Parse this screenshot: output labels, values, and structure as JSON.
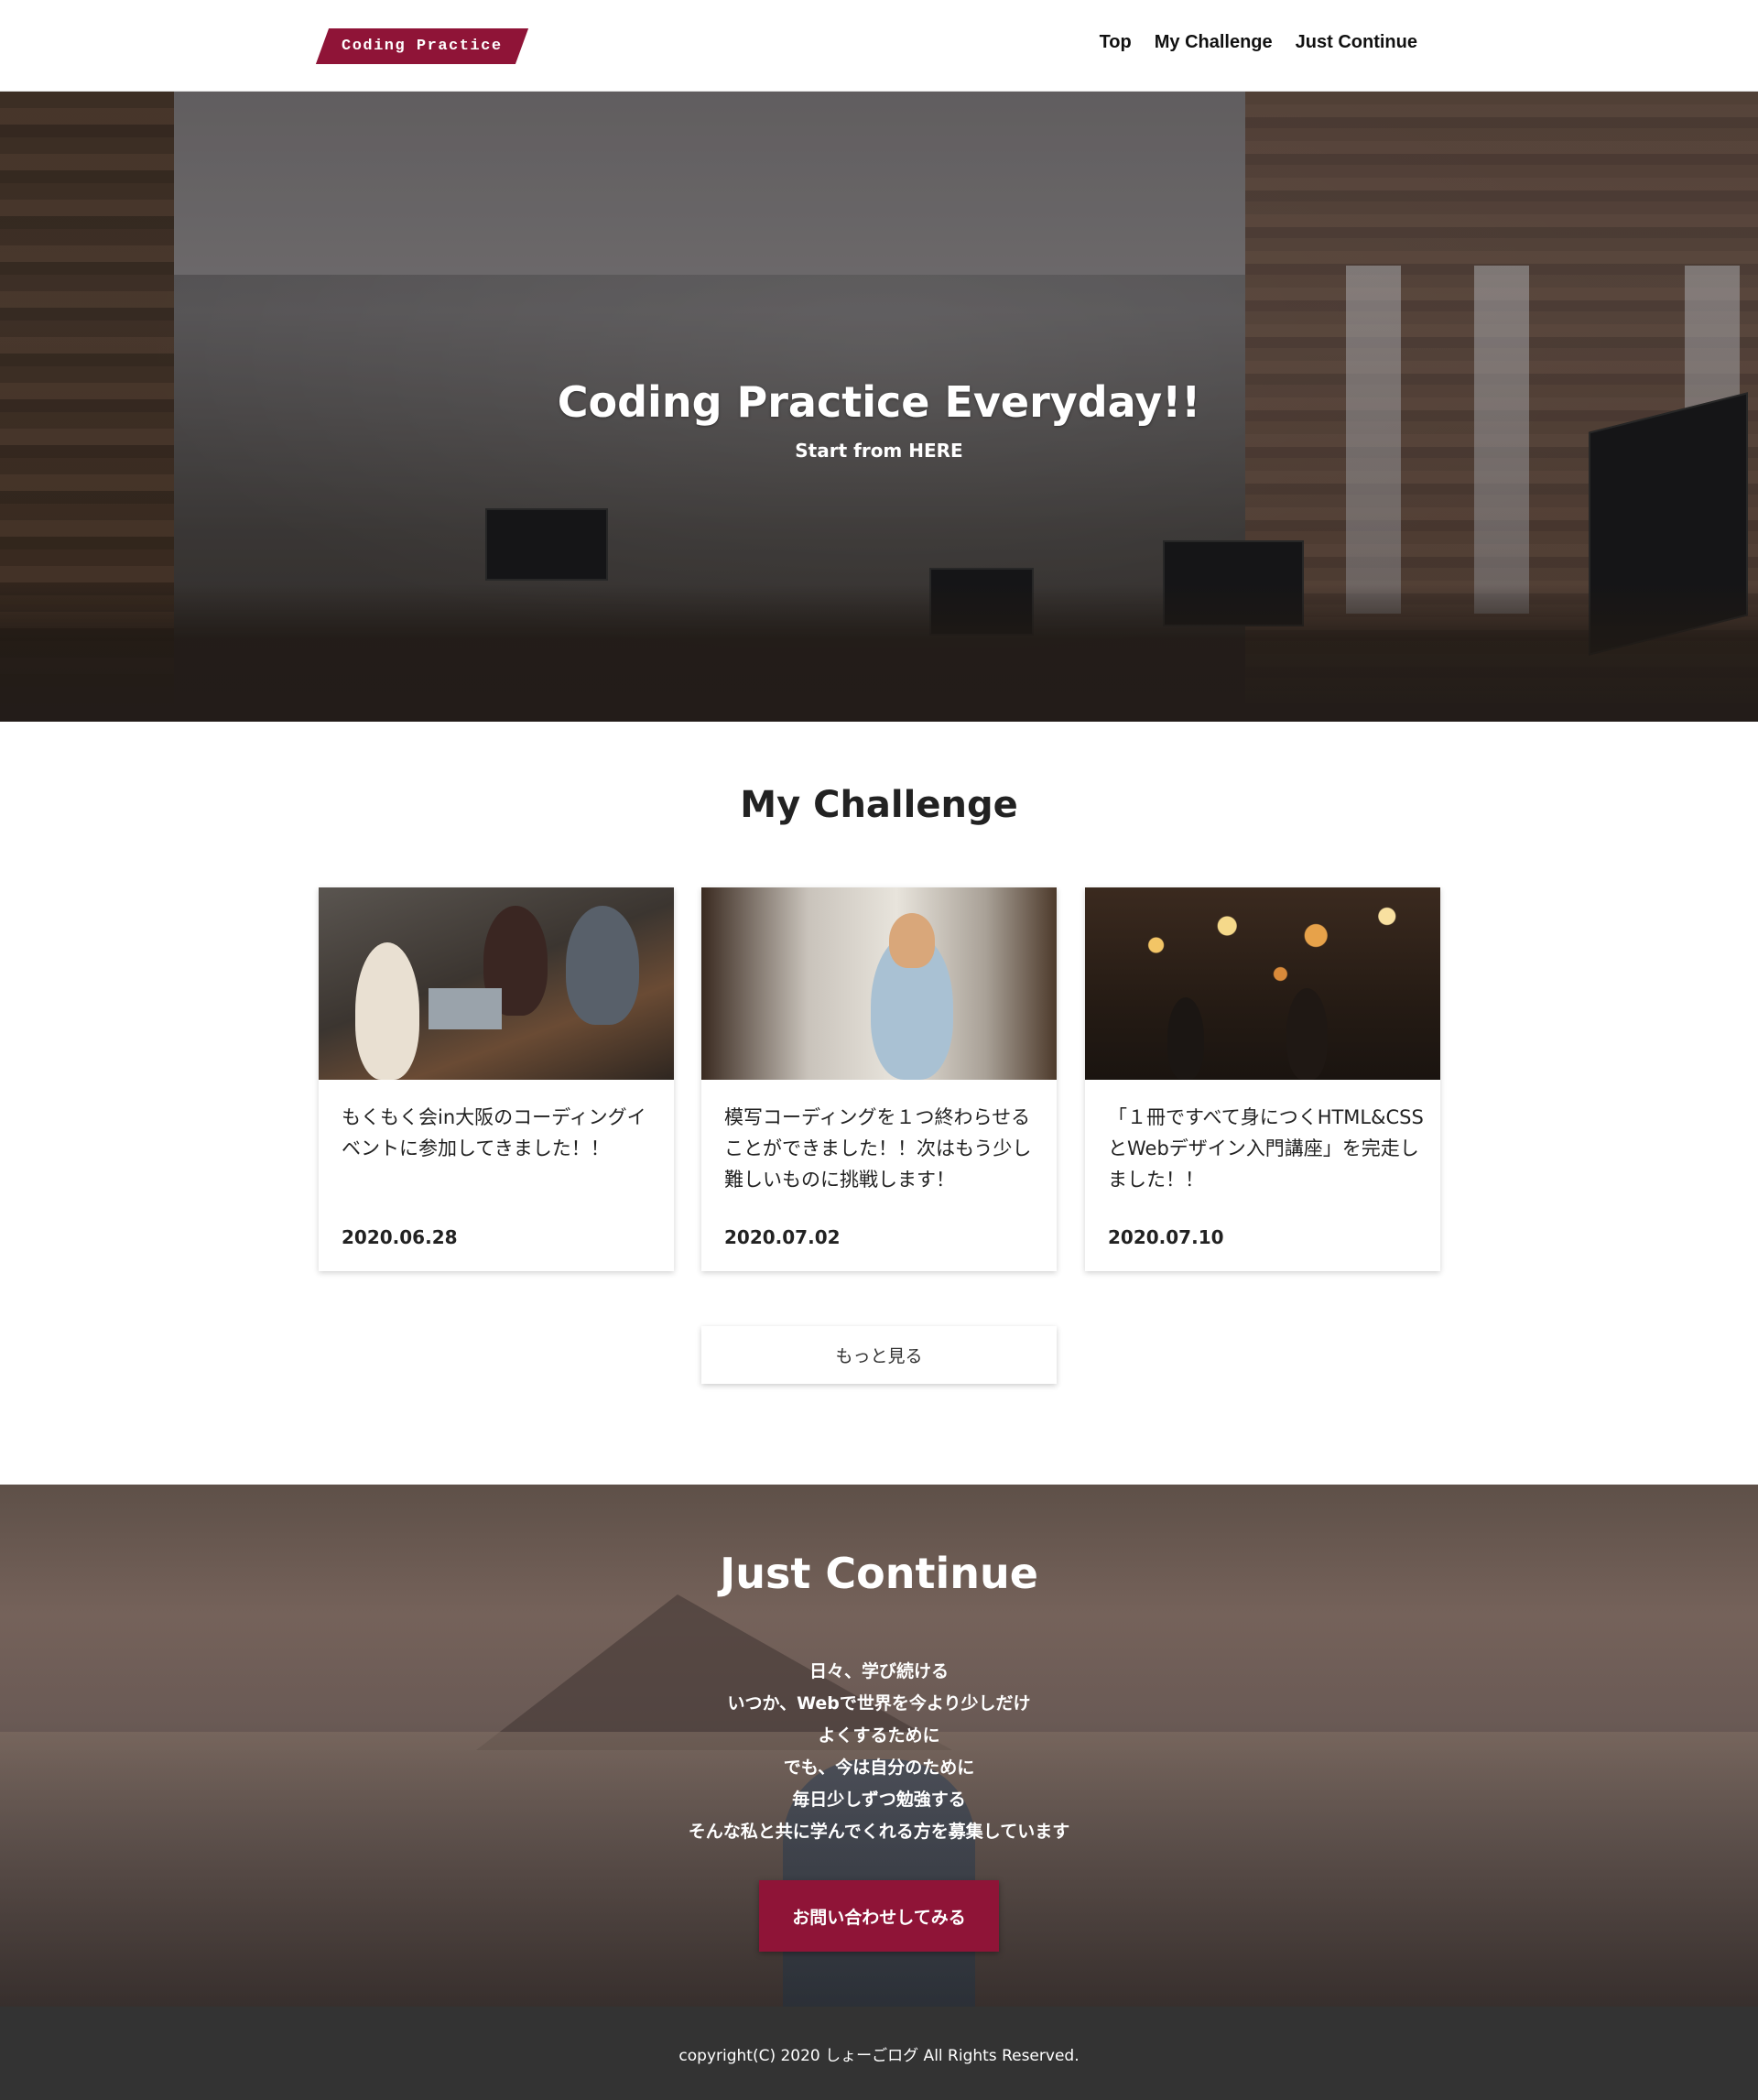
{
  "header": {
    "logo": "Coding Practice",
    "nav": [
      "Top",
      "My Challenge",
      "Just Continue"
    ]
  },
  "hero": {
    "title": "Coding Practice Everyday!!",
    "subtitle": "Start from HERE"
  },
  "challenge": {
    "title": "My Challenge",
    "cards": [
      {
        "title": "もくもく会in大阪のコーディングイベントに参加してきました！！",
        "date": "2020.06.28"
      },
      {
        "title": "模写コーディングを１つ終わらせることができました！！次はもう少し難しいものに挑戦します！",
        "date": "2020.07.02"
      },
      {
        "title": "「１冊ですべて身につくHTML&CSSとWebデザイン入門講座」を完走しました！！",
        "date": "2020.07.10"
      }
    ],
    "more_button": "もっと見る"
  },
  "continue": {
    "title": "Just Continue",
    "lines": [
      "日々、学び続ける",
      "いつか、Webで世界を今より少しだけ",
      "よくするために",
      "でも、今は自分のために",
      "毎日少しずつ勉強する",
      "そんな私と共に学んでくれる方を募集しています"
    ],
    "contact_button": "お問い合わせしてみる"
  },
  "footer": {
    "copyright": "copyright(C) 2020 しょーごログ All Rights Reserved."
  },
  "colors": {
    "brand": "#8f1437",
    "footer_bg": "#333333"
  }
}
